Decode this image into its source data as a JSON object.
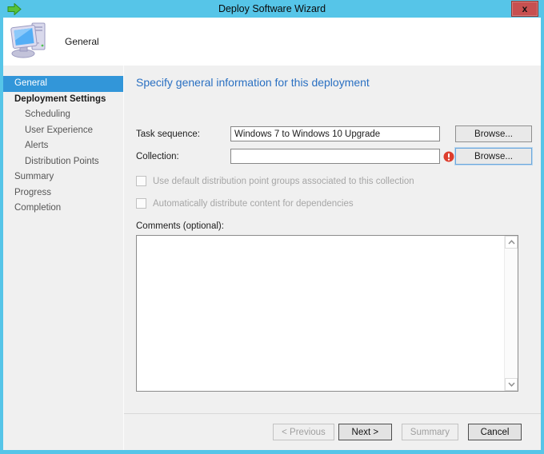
{
  "window": {
    "title": "Deploy Software Wizard",
    "close_glyph": "x"
  },
  "header": {
    "title": "General"
  },
  "sidebar": {
    "items": [
      {
        "label": "General",
        "level": 0,
        "selected": true
      },
      {
        "label": "Deployment Settings",
        "level": 0,
        "bold": true
      },
      {
        "label": "Scheduling",
        "level": 1
      },
      {
        "label": "User Experience",
        "level": 1
      },
      {
        "label": "Alerts",
        "level": 1
      },
      {
        "label": "Distribution Points",
        "level": 1
      },
      {
        "label": "Summary",
        "level": 0
      },
      {
        "label": "Progress",
        "level": 0
      },
      {
        "label": "Completion",
        "level": 0
      }
    ]
  },
  "main": {
    "heading": "Specify general information for this deployment",
    "task_sequence": {
      "label": "Task sequence:",
      "value": "Windows 7 to Windows 10 Upgrade",
      "browse_label": "Browse..."
    },
    "collection": {
      "label": "Collection:",
      "value": "",
      "browse_label": "Browse...",
      "has_error": true
    },
    "checkboxes": [
      {
        "label": "Use default distribution point groups associated to this collection",
        "checked": false,
        "disabled": true
      },
      {
        "label": "Automatically distribute content for dependencies",
        "checked": false,
        "disabled": true
      }
    ],
    "comments": {
      "label": "Comments (optional):",
      "value": ""
    }
  },
  "footer": {
    "buttons": [
      {
        "label": "< Previous",
        "disabled": true
      },
      {
        "label": "Next >",
        "disabled": false
      },
      {
        "label": "Summary",
        "disabled": true
      },
      {
        "label": "Cancel",
        "disabled": false
      }
    ]
  },
  "icons": {
    "wizard_icon": "green-arrow-right",
    "close_icon": "x-glyph",
    "header_icon": "computer-workstation",
    "error_icon": "red-circle-exclamation",
    "scroll_up_icon": "chevron-up",
    "scroll_down_icon": "chevron-down"
  },
  "colors": {
    "titlebar": "#56c5e8",
    "selection_blue": "#3296d9",
    "heading_blue": "#2a70c2",
    "close_red": "#c75050",
    "error_red": "#dd3d2d",
    "body_gray": "#f0f0f0"
  }
}
